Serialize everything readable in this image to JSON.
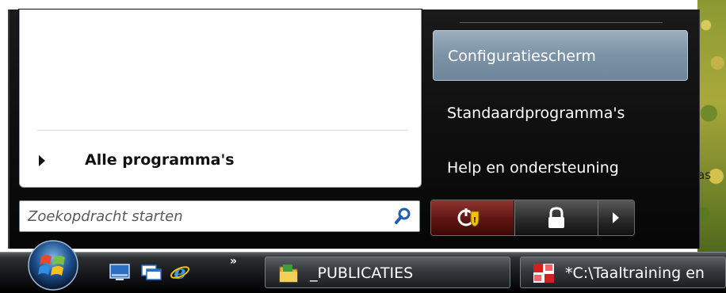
{
  "start_menu": {
    "all_programs": "Alle programma's",
    "search": {
      "placeholder": "Zoekopdracht starten",
      "value": ""
    },
    "right_items": [
      {
        "label": "Configuratiescherm",
        "active": true
      },
      {
        "label": "Standaardprogramma's",
        "active": false
      },
      {
        "label": "Help en ondersteuning",
        "active": false
      }
    ],
    "power": {
      "shutdown_icon": "shield-power-icon",
      "lock_icon": "lock-icon",
      "menu_icon": "arrow-right-icon"
    }
  },
  "desktop": {
    "visible_text": "as"
  },
  "taskbar": {
    "start_icon": "windows-orb-icon",
    "quick_launch": [
      "show-desktop-icon",
      "switch-windows-icon",
      "internet-explorer-icon"
    ],
    "overflow": "»",
    "tasks": [
      {
        "label": "_PUBLICATIES",
        "icon": "folder-icon"
      },
      {
        "label": "*C:\\Taaltraining en",
        "icon": "application-icon"
      }
    ]
  },
  "colors": {
    "highlight": "#7c93a6",
    "shutdown": "#8f3430",
    "frame": "#0e0e0e"
  }
}
